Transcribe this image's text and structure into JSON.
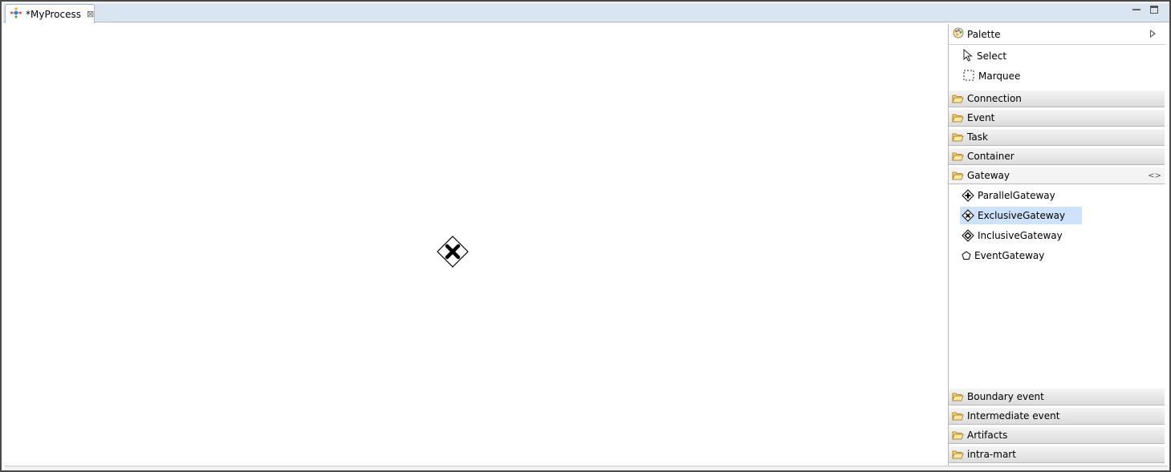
{
  "editor": {
    "tab_title": "*MyProcess",
    "tab_close_icon": "close-icon"
  },
  "canvas": {
    "shape": "exclusive-gateway"
  },
  "palette": {
    "title": "Palette",
    "tools": [
      {
        "label": "Select",
        "icon": "cursor-arrow-icon"
      },
      {
        "label": "Marquee",
        "icon": "marquee-icon"
      }
    ],
    "drawers": {
      "connection": "Connection",
      "event": "Event",
      "task": "Task",
      "container": "Container",
      "gateway": "Gateway",
      "boundary_event": "Boundary event",
      "intermediate_event": "Intermediate event",
      "artifacts": "Artifacts",
      "intra_mart": "intra-mart"
    },
    "gateway_entries": [
      {
        "label": "ParallelGateway"
      },
      {
        "label": "ExclusiveGateway"
      },
      {
        "label": "InclusiveGateway"
      },
      {
        "label": "EventGateway"
      }
    ],
    "selected_entry": "ExclusiveGateway"
  },
  "colors": {
    "tabbar": "#dbe4f1",
    "selection": "#cfe2fb",
    "folder": "#e8b64a"
  }
}
